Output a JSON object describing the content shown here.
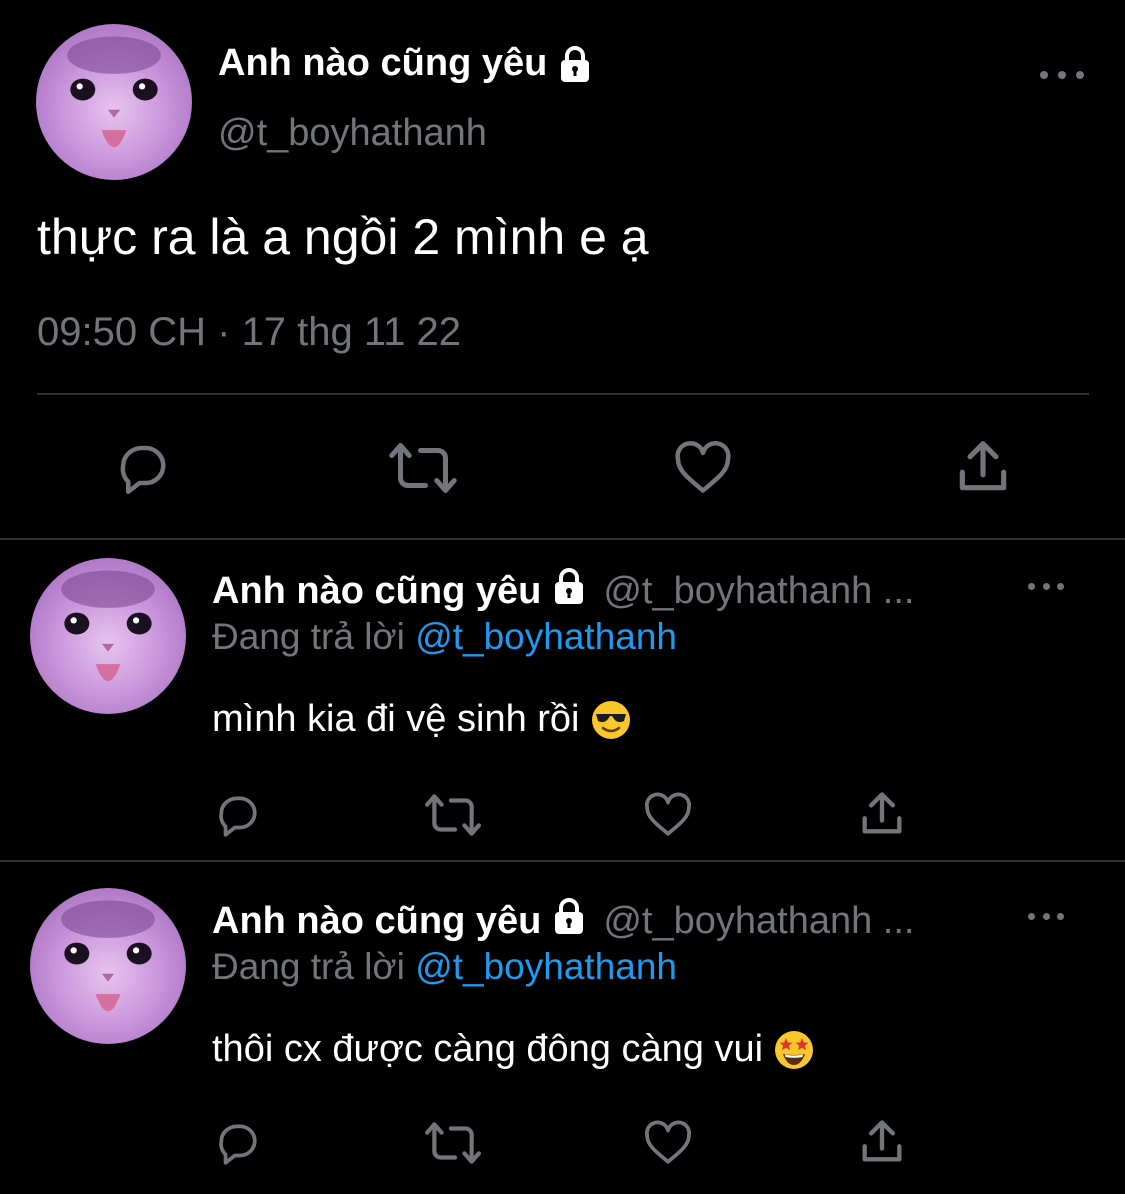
{
  "main_tweet": {
    "display_name": "Anh nào cũng yêu",
    "handle": "@t_boyhathanh",
    "text": "thực ra là a ngồi 2 mình e ạ",
    "time": "09:50 CH",
    "separator": "·",
    "date": "17 thg 11 22",
    "icons": {
      "lock": "lock-icon",
      "more": "more-horizontal-icon",
      "reply": "reply-icon",
      "retweet": "retweet-icon",
      "like": "heart-icon",
      "share": "share-icon"
    }
  },
  "replies": [
    {
      "display_name": "Anh nào cũng yêu",
      "handle": "@t_boyhathanh ...",
      "replying_label": "Đang trả lời",
      "replying_to": "@t_boyhathanh",
      "text": "mình kia đi vệ sinh rồi",
      "emoji": "smiling-face-with-sunglasses-emoji"
    },
    {
      "display_name": "Anh nào cũng yêu",
      "handle": "@t_boyhathanh ...",
      "replying_label": "Đang trả lời",
      "replying_to": "@t_boyhathanh",
      "text": "thôi cx được càng đông càng vui",
      "emoji": "star-struck-emoji"
    }
  ],
  "colors": {
    "background": "#000000",
    "primary_text": "#ffffff",
    "secondary_text": "#71767b",
    "link": "#1d9bf0",
    "divider": "#2f3336",
    "avatar_tint": "#c995dc"
  }
}
